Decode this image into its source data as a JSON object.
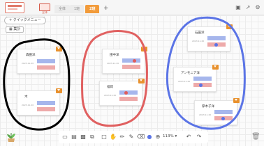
{
  "tabs": [
    {
      "label": "全体"
    },
    {
      "label": "1班"
    },
    {
      "label": "2班"
    }
  ],
  "thumbnail_label": "全体",
  "add_tab_label": "+",
  "quick_menu_label": "+ クイックメニュー",
  "sum_label": "集計",
  "cards": [
    {
      "title": "森田洋"
    },
    {
      "title": "木"
    },
    {
      "title": "田中洋"
    },
    {
      "title": "福岡"
    },
    {
      "title": "石田洋"
    },
    {
      "title": "アンモニア洋"
    },
    {
      "title": "厚木子洋"
    }
  ],
  "card_subtitle": "2023.11.20",
  "zoom_label": "113%",
  "colors": {
    "accent": "#f29b3a",
    "black_circle": "#000000",
    "red_circle": "#e06060",
    "blue_circle": "#5b74e6"
  }
}
